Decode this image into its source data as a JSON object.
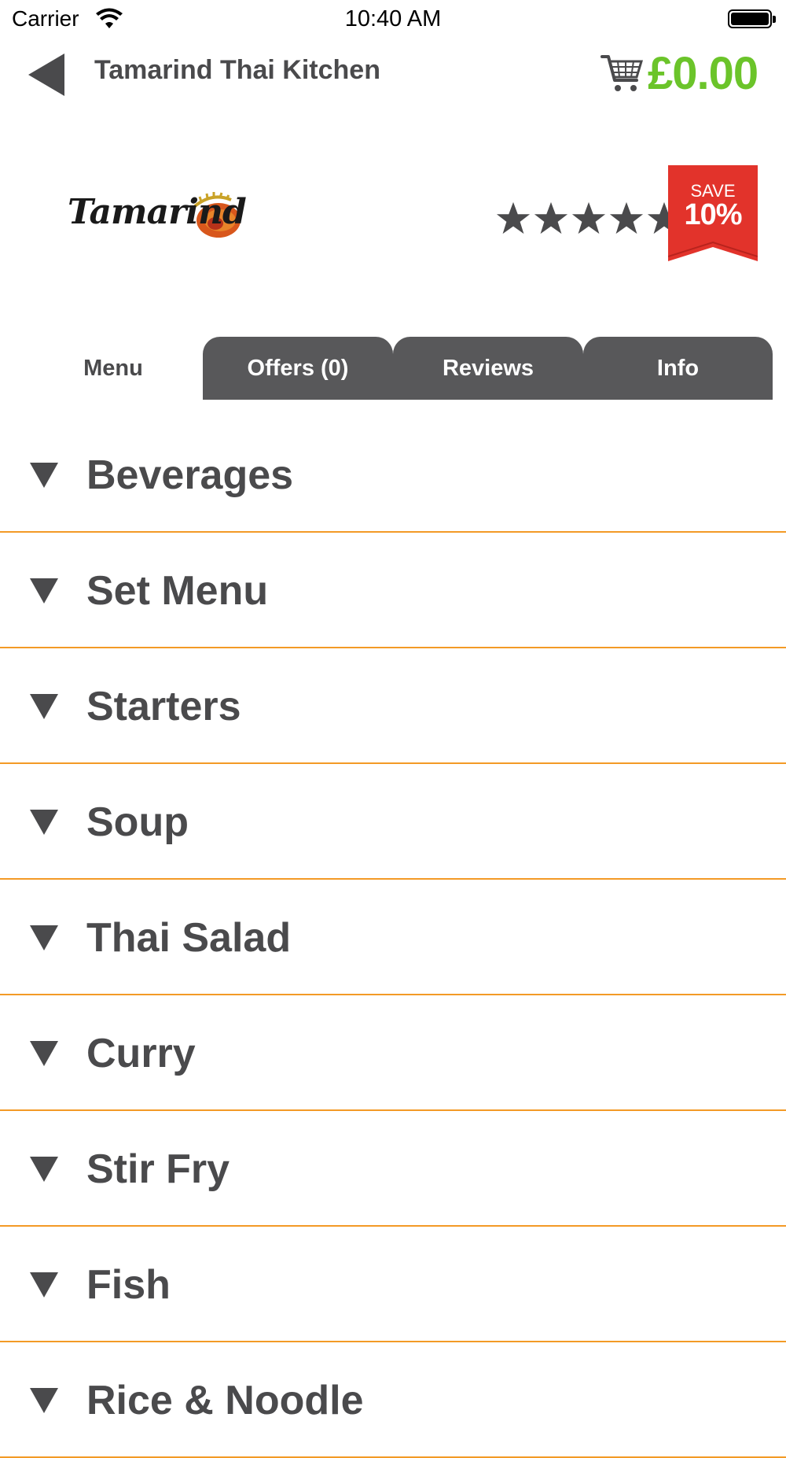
{
  "status_bar": {
    "carrier": "Carrier",
    "time": "10:40 AM"
  },
  "header": {
    "title": "Tamarind Thai Kitchen",
    "cart_total": "£0.00"
  },
  "restaurant": {
    "logo_text": "Tamarind",
    "rating_stars": 5,
    "save_label": "SAVE",
    "save_value": "10%"
  },
  "tabs": [
    {
      "label": "Menu",
      "active": true
    },
    {
      "label": "Offers (0)",
      "active": false
    },
    {
      "label": "Reviews",
      "active": false
    },
    {
      "label": "Info",
      "active": false
    }
  ],
  "categories": [
    {
      "label": "Beverages"
    },
    {
      "label": "Set Menu"
    },
    {
      "label": "Starters"
    },
    {
      "label": "Soup"
    },
    {
      "label": "Thai Salad"
    },
    {
      "label": "Curry"
    },
    {
      "label": "Stir Fry"
    },
    {
      "label": "Fish"
    },
    {
      "label": "Rice & Noodle"
    }
  ],
  "colors": {
    "accent_green": "#6bc42a",
    "divider_orange": "#f39a26",
    "tab_dark": "#58585a",
    "save_red": "#e2332b",
    "text_dark": "#4a4a4c"
  }
}
